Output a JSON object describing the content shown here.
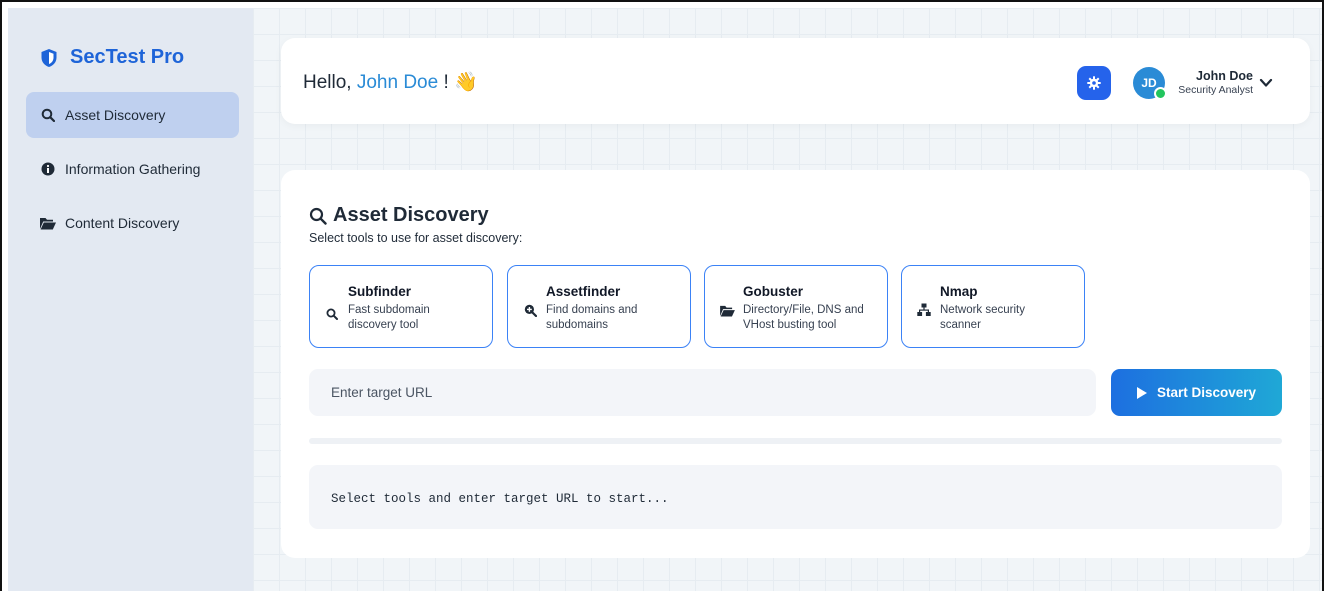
{
  "app": {
    "brand": "SecTest Pro",
    "accent": "#1e64d8"
  },
  "sidebar": {
    "items": [
      {
        "label": "Asset Discovery",
        "icon": "search-icon",
        "active": true
      },
      {
        "label": "Information Gathering",
        "icon": "info-circle-icon",
        "active": false
      },
      {
        "label": "Content Discovery",
        "icon": "folder-open-icon",
        "active": false
      }
    ]
  },
  "header": {
    "greeting_prefix": "Hello, ",
    "user_first": "John Doe",
    "greeting_suffix": " ! ",
    "wave_emoji": "👋",
    "settings_icon": "gear-icon",
    "avatar_initials": "JD",
    "user_name": "John Doe",
    "user_role": "Security Analyst",
    "status_color": "#22c55e"
  },
  "main": {
    "title": "Asset Discovery",
    "subtitle": "Select tools to use for asset discovery:",
    "tools": [
      {
        "name": "Subfinder",
        "desc": "Fast subdomain discovery tool",
        "icon": "search-icon"
      },
      {
        "name": "Assetfinder",
        "desc": "Find domains and subdomains",
        "icon": "search-plus-icon"
      },
      {
        "name": "Gobuster",
        "desc": "Directory/File, DNS and VHost busting tool",
        "icon": "folder-open-icon"
      },
      {
        "name": "Nmap",
        "desc": "Network security scanner",
        "icon": "network-icon"
      }
    ],
    "target_placeholder": "Enter target URL",
    "target_value": "",
    "start_label": "Start Discovery",
    "output_text": "Select tools and enter target URL to start..."
  }
}
